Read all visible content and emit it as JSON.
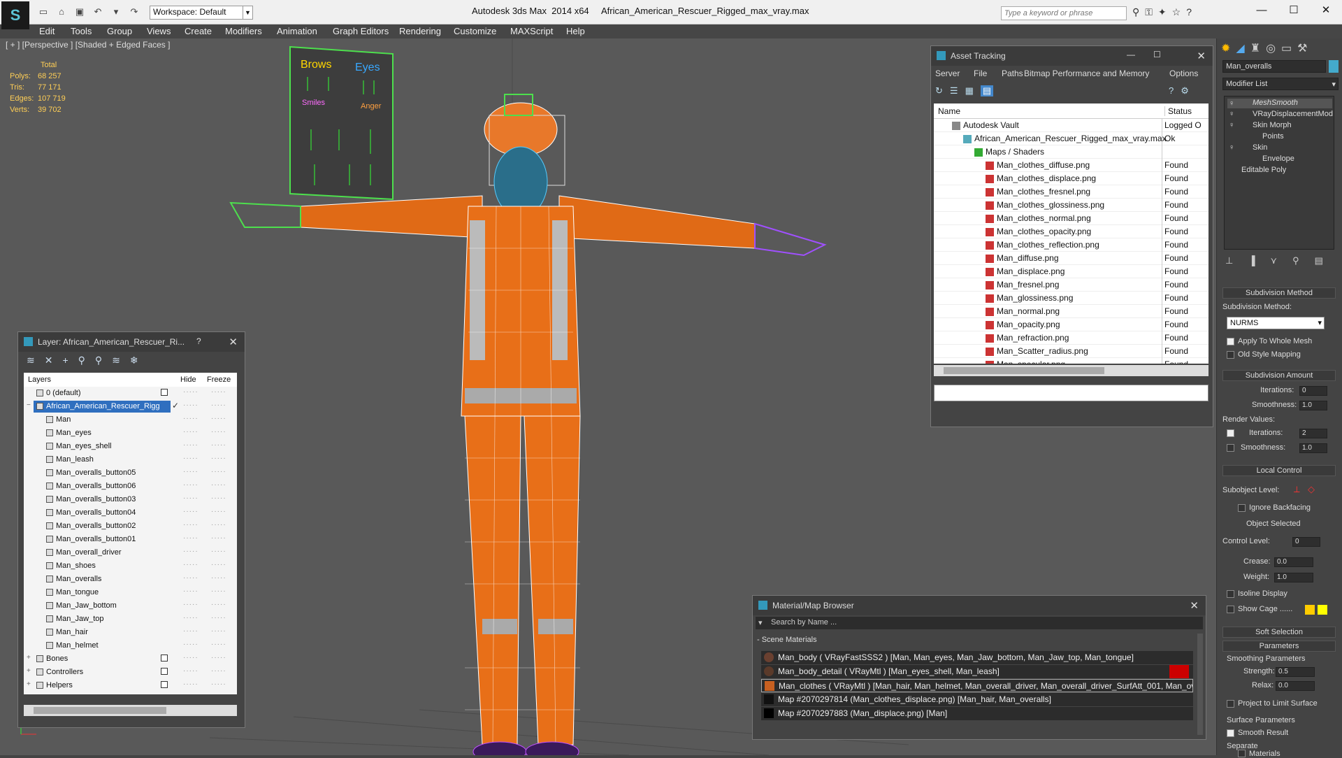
{
  "app": {
    "title": "Autodesk 3ds Max  2014 x64     African_American_Rescuer_Rigged_max_vray.max",
    "workspace": "Workspace: Default",
    "search_placeholder": "Type a keyword or phrase"
  },
  "menu": [
    "Edit",
    "Tools",
    "Group",
    "Views",
    "Create",
    "Modifiers",
    "Animation",
    "Graph Editors",
    "Rendering",
    "Customize",
    "MAXScript",
    "Help"
  ],
  "viewport": {
    "label": "[ + ] [Perspective ] [Shaded + Edged Faces ]",
    "stats": {
      "header": "Total",
      "polys_label": "Polys:",
      "polys": "68 257",
      "tris_label": "Tris:",
      "tris": "77 171",
      "edges_label": "Edges:",
      "edges": "107 719",
      "verts_label": "Verts:",
      "verts": "39 702"
    },
    "face_board": {
      "brows": "Brows",
      "eyes": "Eyes",
      "smiles": "Smiles",
      "anger": "Anger"
    }
  },
  "layer_panel": {
    "title": "Layer: African_American_Rescuer_Ri...",
    "help": "?",
    "cols": {
      "layers": "Layers",
      "hide": "Hide",
      "freeze": "Freeze"
    },
    "rows": [
      "0 (default)",
      "African_American_Rescuer_Rigg",
      "Man",
      "Man_eyes",
      "Man_eyes_shell",
      "Man_leash",
      "Man_overalls_button05",
      "Man_overalls_button06",
      "Man_overalls_button03",
      "Man_overalls_button04",
      "Man_overalls_button02",
      "Man_overalls_button01",
      "Man_overall_driver",
      "Man_shoes",
      "Man_overalls",
      "Man_tongue",
      "Man_Jaw_bottom",
      "Man_Jaw_top",
      "Man_hair",
      "Man_helmet",
      "Bones",
      "Controllers",
      "Helpers"
    ]
  },
  "asset_panel": {
    "title": "Asset Tracking",
    "menu": [
      "Server",
      "File",
      "Paths",
      "Bitmap Performance and Memory",
      "Options"
    ],
    "cols": {
      "name": "Name",
      "status": "Status"
    },
    "rows": [
      {
        "name": "Autodesk Vault",
        "status": "Logged O"
      },
      {
        "name": "African_American_Rescuer_Rigged_max_vray.max",
        "status": "Ok"
      },
      {
        "name": "Maps / Shaders",
        "status": ""
      },
      {
        "name": "Man_clothes_diffuse.png",
        "status": "Found"
      },
      {
        "name": "Man_clothes_displace.png",
        "status": "Found"
      },
      {
        "name": "Man_clothes_fresnel.png",
        "status": "Found"
      },
      {
        "name": "Man_clothes_glossiness.png",
        "status": "Found"
      },
      {
        "name": "Man_clothes_normal.png",
        "status": "Found"
      },
      {
        "name": "Man_clothes_opacity.png",
        "status": "Found"
      },
      {
        "name": "Man_clothes_reflection.png",
        "status": "Found"
      },
      {
        "name": "Man_diffuse.png",
        "status": "Found"
      },
      {
        "name": "Man_displace.png",
        "status": "Found"
      },
      {
        "name": "Man_fresnel.png",
        "status": "Found"
      },
      {
        "name": "Man_glossiness.png",
        "status": "Found"
      },
      {
        "name": "Man_normal.png",
        "status": "Found"
      },
      {
        "name": "Man_opacity.png",
        "status": "Found"
      },
      {
        "name": "Man_refraction.png",
        "status": "Found"
      },
      {
        "name": "Man_Scatter_radius.png",
        "status": "Found"
      },
      {
        "name": "Man_specular.png",
        "status": "Found"
      }
    ]
  },
  "material_panel": {
    "title": "Material/Map Browser",
    "search_placeholder": "Search by Name ...",
    "section": "- Scene Materials",
    "rows": [
      "Man_body  ( VRayFastSSS2 ) [Man, Man_eyes, Man_Jaw_bottom, Man_Jaw_top, Man_tongue]",
      "Man_body_detail  ( VRayMtl ) [Man_eyes_shell, Man_leash]",
      "Man_clothes  ( VRayMtl ) [Man_hair, Man_helmet, Man_overall_driver, Man_overall_driver_SurfAtt_001, Man_overa...",
      "Map #2070297814 (Man_clothes_displace.png) [Man_hair, Man_overalls]",
      "Map #2070297883 (Man_displace.png) [Man]"
    ]
  },
  "command_panel": {
    "object_name": "Man_overalls",
    "modifier_list": "Modifier List",
    "stack": [
      "MeshSmooth",
      "VRayDisplacementMod",
      "Skin Morph",
      "Points",
      "Skin",
      "Envelope",
      "Editable Poly"
    ],
    "sections": {
      "subdiv_method": "Subdivision Method",
      "subdiv_method_label": "Subdivision Method:",
      "subdiv_method_value": "NURMS",
      "apply_whole": "Apply To Whole Mesh",
      "old_style": "Old Style Mapping",
      "subdiv_amount": "Subdivision Amount",
      "iterations": "Iterations:",
      "iterations_val": "0",
      "smoothness": "Smoothness:",
      "smoothness_val": "1.0",
      "render_values": "Render Values:",
      "r_iterations_val": "2",
      "r_smoothness_val": "1.0",
      "local_control": "Local Control",
      "subobject_level": "Subobject Level:",
      "ignore_backfacing": "Ignore Backfacing",
      "object_selected": "Object Selected",
      "control_level": "Control Level:",
      "control_level_val": "0",
      "crease": "Crease:",
      "crease_val": "0.0",
      "weight": "Weight:",
      "weight_val": "1.0",
      "isoline": "Isoline Display",
      "show_cage": "Show Cage ......",
      "soft_selection": "Soft Selection",
      "parameters": "Parameters",
      "smoothing_params": "Smoothing Parameters",
      "strength": "Strength:",
      "strength_val": "0.5",
      "relax": "Relax:",
      "relax_val": "0.0",
      "project_limit": "Project to Limit Surface",
      "surface_params": "Surface Parameters",
      "smooth_result": "Smooth Result",
      "separate": "Separate",
      "materials": "Materials"
    }
  }
}
